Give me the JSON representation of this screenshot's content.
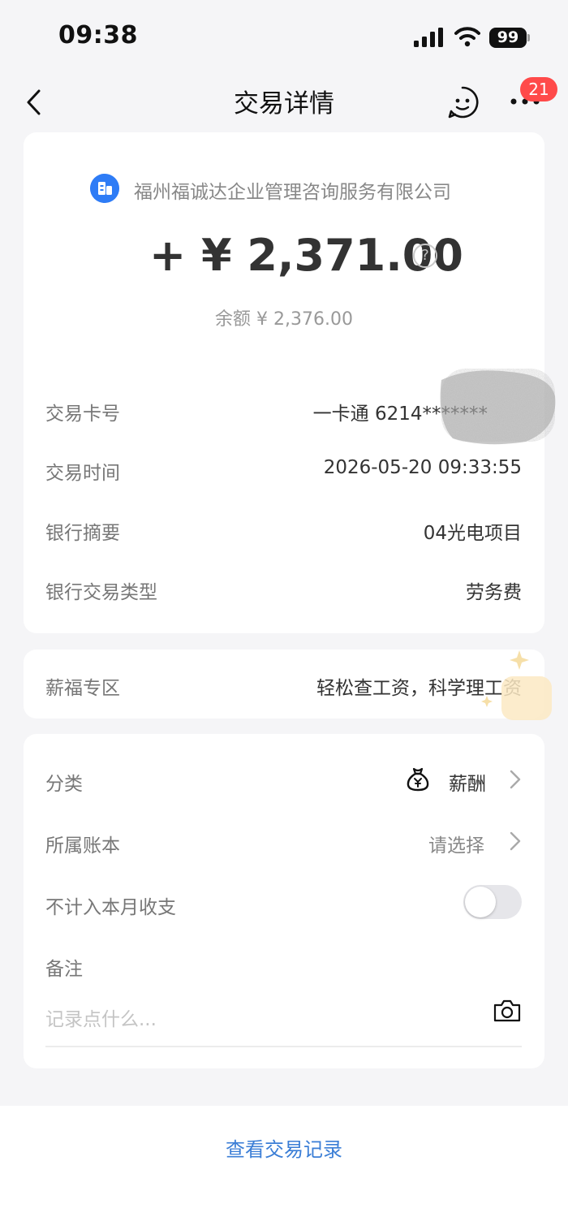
{
  "status_bar": {
    "time": "09:38",
    "battery": "99"
  },
  "nav": {
    "title": "交易详情",
    "badge_count": "21"
  },
  "transaction": {
    "merchant": "福州福诚达企业管理咨询服务有限公司",
    "amount": "+ ¥ 2,371.00",
    "help_symbol": "?",
    "balance": "余额 ¥ 2,376.00",
    "details": [
      {
        "label": "交易卡号",
        "value": "一卡通 6214*******"
      },
      {
        "label": "交易时间",
        "value": "2026-05-20 09:33:55"
      },
      {
        "label": "银行摘要",
        "value": "04光电项目"
      },
      {
        "label": "银行交易类型",
        "value": "劳务费"
      }
    ]
  },
  "promo": {
    "label": "薪福专区",
    "value": "轻松查工资，科学理工资"
  },
  "meta": {
    "category_label": "分类",
    "category_value": "薪酬",
    "ledger_label": "所属账本",
    "ledger_value": "请选择",
    "exclude_label": "不计入本月收支",
    "exclude_enabled": false,
    "note_label": "备注",
    "note_placeholder": "记录点什么..."
  },
  "footer": {
    "history_link": "查看交易记录"
  },
  "colors": {
    "accent_blue": "#3b7ed6",
    "merchant_logo": "#2e7cf6",
    "badge_red": "#ff4a4a"
  },
  "icons": [
    "back-icon",
    "chat-icon",
    "more-icon",
    "help-icon",
    "moneybag-icon",
    "chevron-icon",
    "camera-icon"
  ]
}
